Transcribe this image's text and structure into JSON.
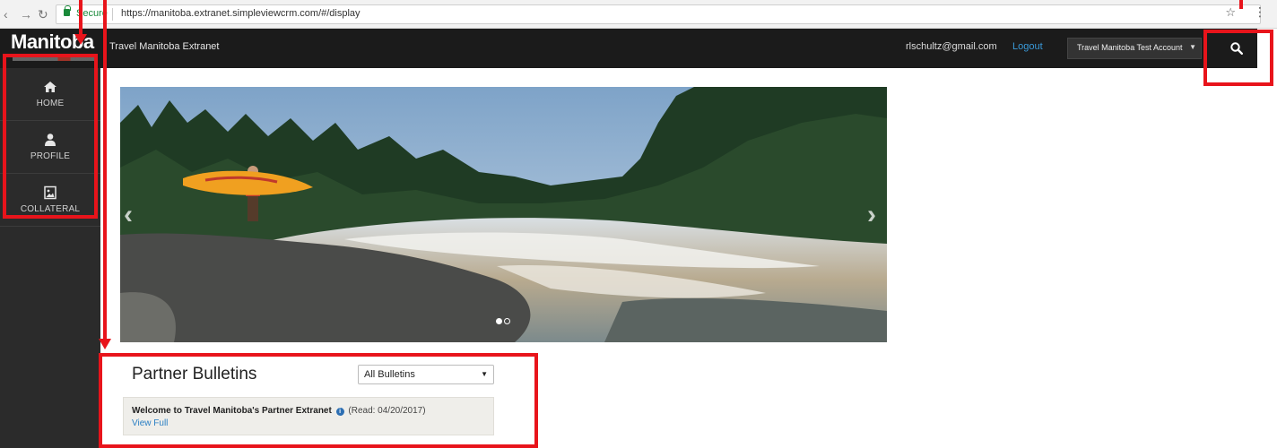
{
  "browser": {
    "secure_label": "Secure",
    "url": "https://manitoba.extranet.simpleviewcrm.com/#/display",
    "back_icon": "back-arrow-icon",
    "forward_icon": "forward-arrow-icon",
    "reload_icon": "reload-icon",
    "star_icon": "star-icon"
  },
  "header": {
    "logo": "Manitoba",
    "site_title": "Travel Manitoba Extranet",
    "user_email": "rlschultz@gmail.com",
    "logout_label": "Logout",
    "account_label": "Travel Manitoba Test Account",
    "search_icon": "search-icon"
  },
  "sidebar": {
    "items": [
      {
        "label": "HOME",
        "icon": "home-icon"
      },
      {
        "label": "PROFILE",
        "icon": "user-icon"
      },
      {
        "label": "COLLATERAL",
        "icon": "image-icon"
      }
    ]
  },
  "hero": {
    "slide_count": 2,
    "active_slide": 1
  },
  "bulletins": {
    "title": "Partner Bulletins",
    "filter_value": "All Bulletins",
    "items": [
      {
        "headline": "Welcome to Travel Manitoba's Partner Extranet",
        "read_text": "(Read: 04/20/2017)",
        "link_label": "View Full"
      }
    ]
  },
  "colors": {
    "topnav": "#1b1b1b",
    "sidebar": "#2b2b2b",
    "link": "#3a9ad9",
    "annotation": "#e8141b"
  }
}
